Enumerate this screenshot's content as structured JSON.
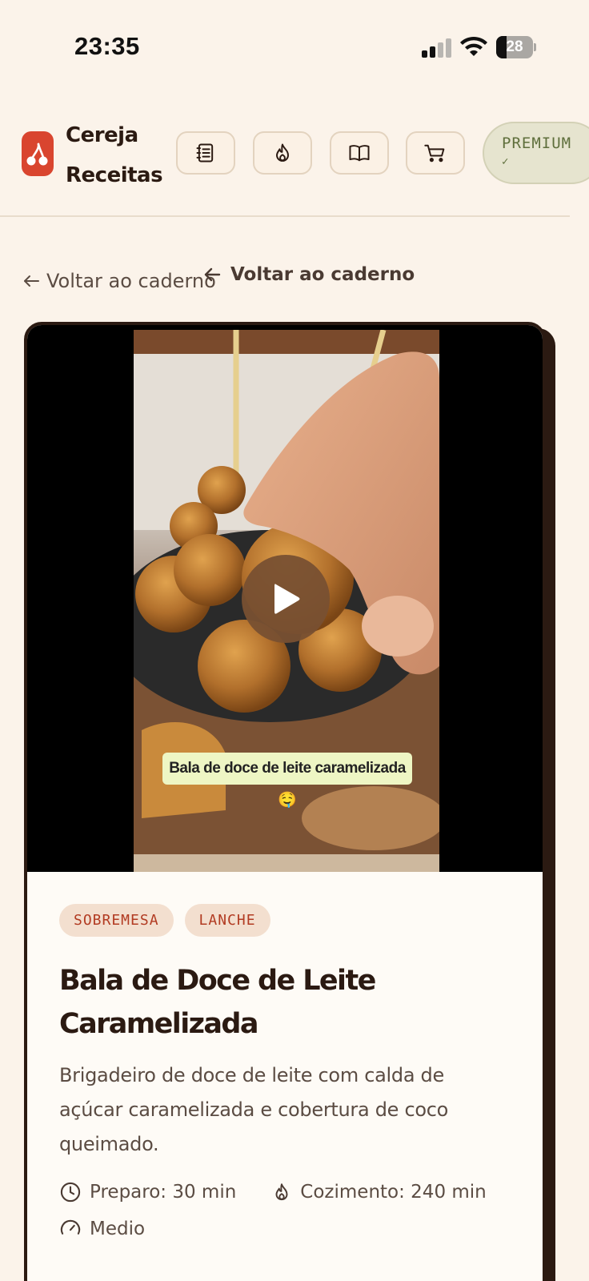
{
  "status": {
    "time": "23:35",
    "battery": "28",
    "battery_level_percent": 28
  },
  "header": {
    "brand_line1": "Cereja",
    "brand_line2": "Receitas",
    "nav_icons": [
      "notebook-icon",
      "flame-icon",
      "book-open-icon",
      "cart-icon"
    ],
    "premium_label": "PREMIUM",
    "premium_check": "✓"
  },
  "back": {
    "plain_label": "Voltar ao caderno",
    "bold_label": "Voltar ao caderno"
  },
  "video": {
    "caption": "Bala de doce de leite caramelizada 🤤"
  },
  "recipe": {
    "tags": [
      "SOBREMESA",
      "LANCHE"
    ],
    "title": "Bala de Doce de Leite Caramelizada",
    "description": "Brigadeiro de doce de leite com calda de açúcar caramelizada e cobertura de coco queimado.",
    "prep": "Preparo: 30 min",
    "cook": "Cozimento: 240 min",
    "difficulty": "Medio"
  },
  "colors": {
    "background": "#fbf3ea",
    "accent": "#d9452f",
    "ink": "#2b1a12",
    "tag_bg": "#f3dfcf",
    "tag_text": "#b23b22",
    "premium_bg": "#e6e4cf"
  }
}
